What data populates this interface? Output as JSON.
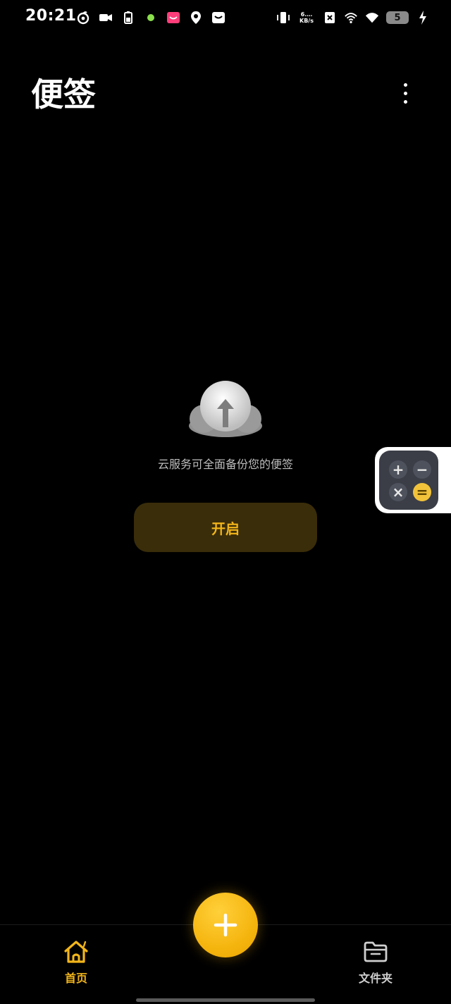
{
  "status_bar": {
    "time": "20:21",
    "net_speed_top": "6.…",
    "net_speed_bottom": "KB/s",
    "battery": "5"
  },
  "header": {
    "title": "便签"
  },
  "empty_state": {
    "message": "云服务可全面备份您的便签",
    "enable_label": "开启"
  },
  "floating_widget": {
    "keys": [
      "+",
      "−",
      "×",
      "="
    ]
  },
  "bottom_nav": {
    "home_label": "首页",
    "folder_label": "文件夹"
  },
  "colors": {
    "accent": "#f2b51a",
    "background": "#000000",
    "button_bg": "#3a2d09"
  }
}
